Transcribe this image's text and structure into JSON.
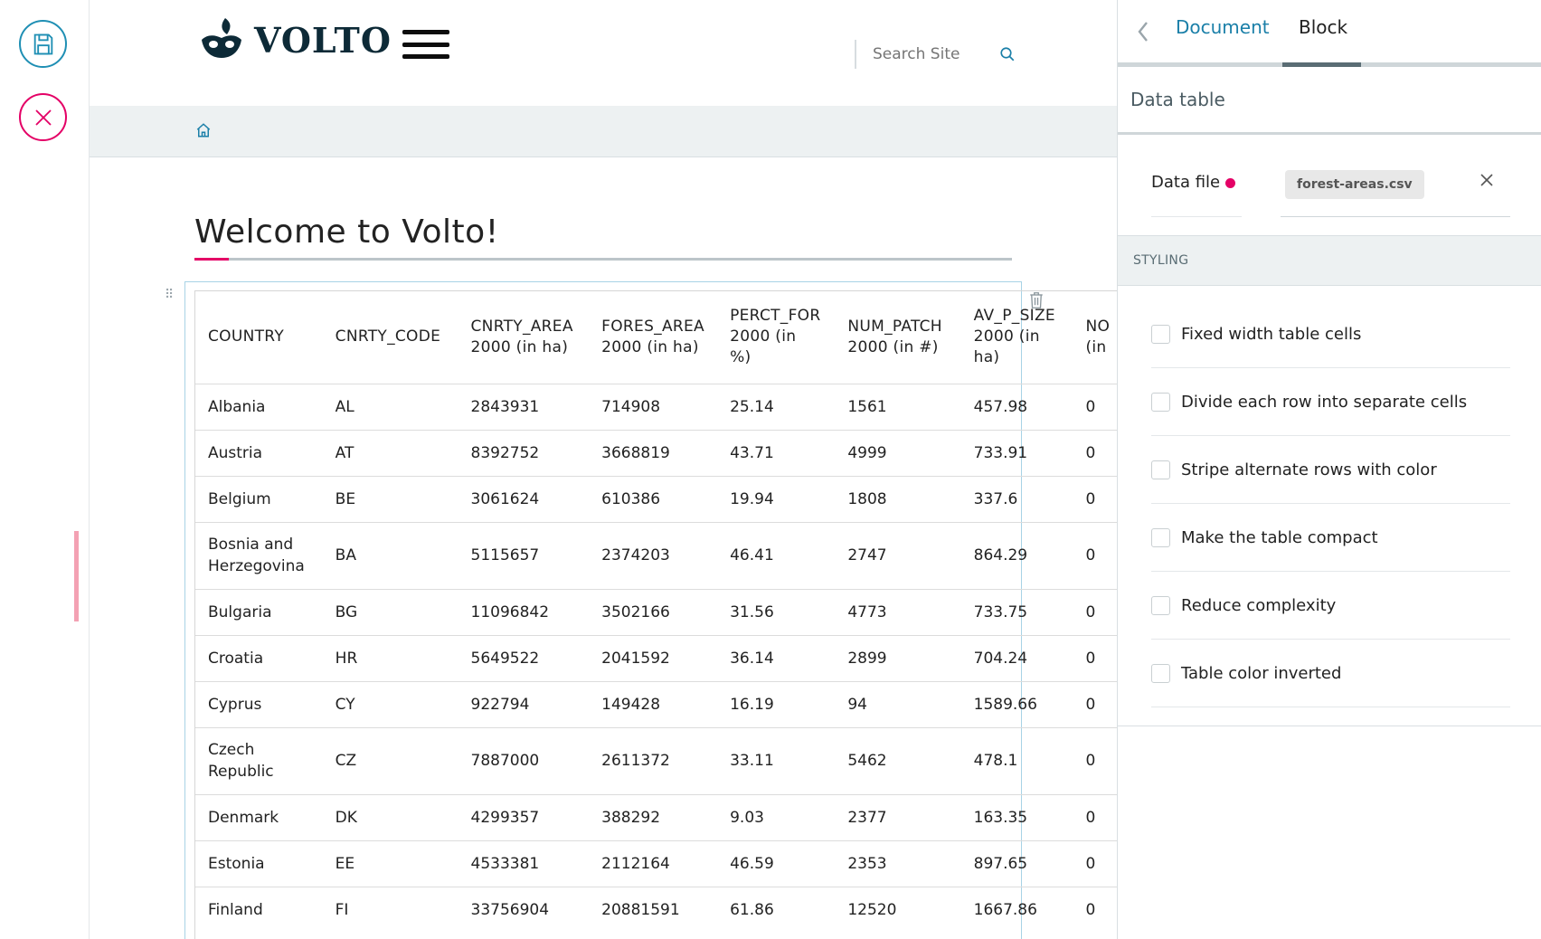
{
  "header": {
    "logo_text": "VOLTO",
    "search_placeholder": "Search Site"
  },
  "page": {
    "title": "Welcome to Volto!"
  },
  "table": {
    "columns": [
      {
        "line1": "COUNTRY",
        "line2": "",
        "line3": ""
      },
      {
        "line1": "CNRTY_CODE",
        "line2": "",
        "line3": ""
      },
      {
        "line1": "CNRTY_AREA",
        "line2": "2000 (in ha)",
        "line3": ""
      },
      {
        "line1": "FORES_AREA",
        "line2": "2000 (in ha)",
        "line3": ""
      },
      {
        "line1": "PERCT_FOR",
        "line2": "2000 (in %)",
        "line3": ""
      },
      {
        "line1": "NUM_PATCH",
        "line2": "2000 (in #)",
        "line3": ""
      },
      {
        "line1": "AV_P_SIZE",
        "line2": "2000 (in",
        "line3": "ha)"
      },
      {
        "line1": "NO",
        "line2": "(in",
        "line3": ""
      }
    ],
    "rows": [
      {
        "country_a": "Albania",
        "country_b": "",
        "code": "AL",
        "area": "2843931",
        "fores": "714908",
        "perct": "25.14",
        "patch": "1561",
        "avp": "457.98",
        "no": "0"
      },
      {
        "country_a": "Austria",
        "country_b": "",
        "code": "AT",
        "area": "8392752",
        "fores": "3668819",
        "perct": "43.71",
        "patch": "4999",
        "avp": "733.91",
        "no": "0"
      },
      {
        "country_a": "Belgium",
        "country_b": "",
        "code": "BE",
        "area": "3061624",
        "fores": "610386",
        "perct": "19.94",
        "patch": "1808",
        "avp": "337.6",
        "no": "0"
      },
      {
        "country_a": "Bosnia and",
        "country_b": "Herzegovina",
        "code": "BA",
        "area": "5115657",
        "fores": "2374203",
        "perct": "46.41",
        "patch": "2747",
        "avp": "864.29",
        "no": "0"
      },
      {
        "country_a": "Bulgaria",
        "country_b": "",
        "code": "BG",
        "area": "11096842",
        "fores": "3502166",
        "perct": "31.56",
        "patch": "4773",
        "avp": "733.75",
        "no": "0"
      },
      {
        "country_a": "Croatia",
        "country_b": "",
        "code": "HR",
        "area": "5649522",
        "fores": "2041592",
        "perct": "36.14",
        "patch": "2899",
        "avp": "704.24",
        "no": "0"
      },
      {
        "country_a": "Cyprus",
        "country_b": "",
        "code": "CY",
        "area": "922794",
        "fores": "149428",
        "perct": "16.19",
        "patch": "94",
        "avp": "1589.66",
        "no": "0"
      },
      {
        "country_a": "Czech",
        "country_b": "Republic",
        "code": "CZ",
        "area": "7887000",
        "fores": "2611372",
        "perct": "33.11",
        "patch": "5462",
        "avp": "478.1",
        "no": "0"
      },
      {
        "country_a": "Denmark",
        "country_b": "",
        "code": "DK",
        "area": "4299357",
        "fores": "388292",
        "perct": "9.03",
        "patch": "2377",
        "avp": "163.35",
        "no": "0"
      },
      {
        "country_a": "Estonia",
        "country_b": "",
        "code": "EE",
        "area": "4533381",
        "fores": "2112164",
        "perct": "46.59",
        "patch": "2353",
        "avp": "897.65",
        "no": "0"
      },
      {
        "country_a": "Finland",
        "country_b": "",
        "code": "FI",
        "area": "33756904",
        "fores": "20881591",
        "perct": "61.86",
        "patch": "12520",
        "avp": "1667.86",
        "no": "0"
      }
    ]
  },
  "sidebar": {
    "tabs": {
      "document": "Document",
      "block": "Block"
    },
    "title": "Data table",
    "data_file_label": "Data file",
    "data_file_value": "forest-areas.csv",
    "styling_label": "STYLING",
    "options": [
      "Fixed width table cells",
      "Divide each row into separate cells",
      "Stripe alternate rows with color",
      "Make the table compact",
      "Reduce complexity",
      "Table color inverted"
    ]
  },
  "colors": {
    "accent_blue": "#1f8fb4",
    "accent_pink": "#e40166"
  },
  "icons": {
    "save": "save-icon",
    "cancel": "close-icon",
    "search": "search-icon",
    "home": "home-icon",
    "back": "chevron-left-icon",
    "trash": "trash-icon",
    "drag": "drag-handle-icon",
    "remove": "close-icon"
  }
}
